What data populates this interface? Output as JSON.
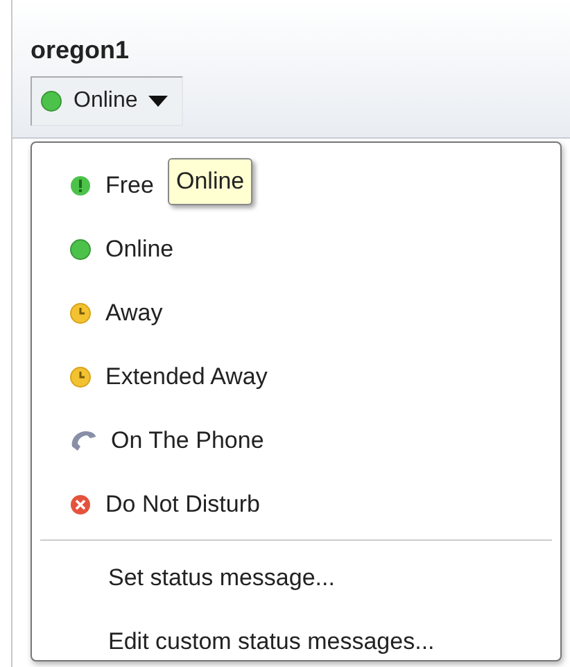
{
  "account": {
    "name": "oregon1"
  },
  "status_button": {
    "label": "Online",
    "kind": "online"
  },
  "tooltip": {
    "text": "Online"
  },
  "menu": {
    "statuses": [
      {
        "label": "Free",
        "kind": "free"
      },
      {
        "label": "Online",
        "kind": "online"
      },
      {
        "label": "Away",
        "kind": "away"
      },
      {
        "label": "Extended Away",
        "kind": "away"
      },
      {
        "label": "On The Phone",
        "kind": "phone"
      },
      {
        "label": "Do Not Disturb",
        "kind": "dnd"
      }
    ],
    "actions": [
      {
        "label": "Set status message..."
      },
      {
        "label": "Edit custom status messages..."
      }
    ]
  }
}
